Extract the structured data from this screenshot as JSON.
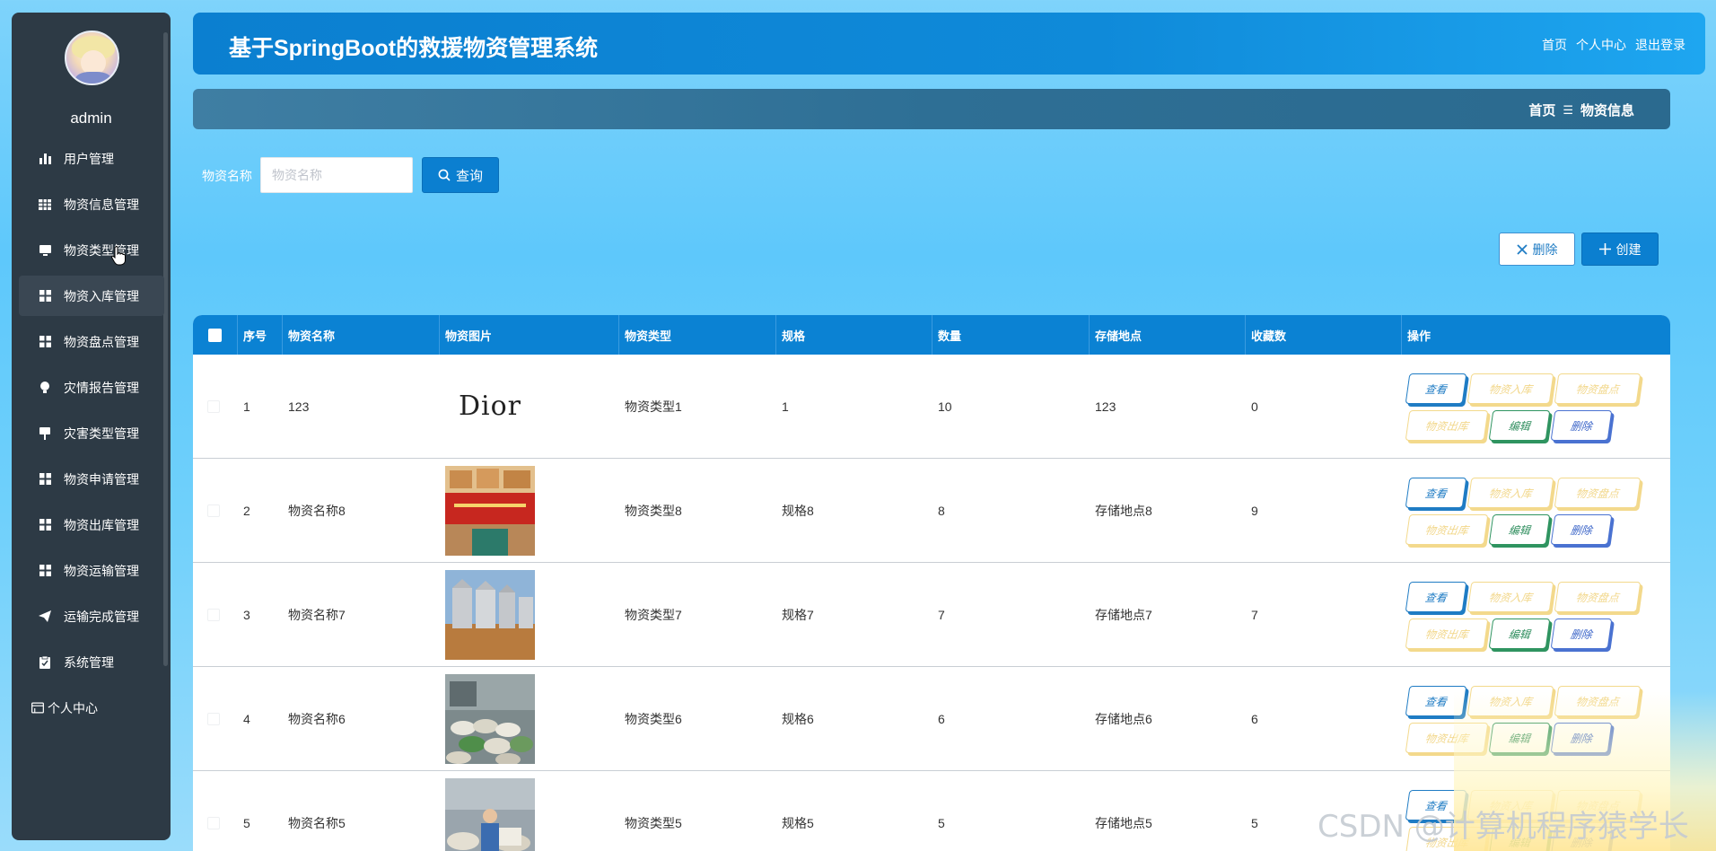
{
  "sidebar": {
    "username": "admin",
    "items": [
      {
        "label": "用户管理",
        "icon": "bar-chart-icon"
      },
      {
        "label": "物资信息管理",
        "icon": "grid-icon"
      },
      {
        "label": "物资类型管理",
        "icon": "monitor-icon"
      },
      {
        "label": "物资入库管理",
        "icon": "apps-icon"
      },
      {
        "label": "物资盘点管理",
        "icon": "apps-icon"
      },
      {
        "label": "灾情报告管理",
        "icon": "bulb-icon"
      },
      {
        "label": "灾害类型管理",
        "icon": "projector-icon"
      },
      {
        "label": "物资申请管理",
        "icon": "apps-icon"
      },
      {
        "label": "物资出库管理",
        "icon": "apps-icon"
      },
      {
        "label": "物资运输管理",
        "icon": "apps-icon"
      },
      {
        "label": "运输完成管理",
        "icon": "send-icon"
      },
      {
        "label": "系统管理",
        "icon": "clipboard-icon"
      },
      {
        "label": "个人中心",
        "icon": "card-icon"
      }
    ]
  },
  "header": {
    "title": "基于SpringBoot的救援物资管理系统",
    "links": [
      "首页",
      "个人中心",
      "退出登录"
    ]
  },
  "breadcrumb": {
    "home": "首页",
    "separator": "☰",
    "current": "物资信息"
  },
  "search": {
    "label": "物资名称",
    "placeholder": "物资名称",
    "value": "",
    "button": "查询"
  },
  "actions": {
    "delete": "删除",
    "create": "创建"
  },
  "table": {
    "headers": [
      "序号",
      "物资名称",
      "物资图片",
      "物资类型",
      "规格",
      "数量",
      "存储地点",
      "收藏数",
      "操作"
    ],
    "rows": [
      {
        "no": "1",
        "name": "123",
        "image": "Dior",
        "type": "物资类型1",
        "spec": "1",
        "qty": "10",
        "location": "123",
        "favorites": "0"
      },
      {
        "no": "2",
        "name": "物资名称8",
        "image": "warehouse-boxes-photo",
        "type": "物资类型8",
        "spec": "规格8",
        "qty": "8",
        "location": "存储地点8",
        "favorites": "9"
      },
      {
        "no": "3",
        "name": "物资名称7",
        "image": "grain-silos-photo",
        "type": "物资类型7",
        "spec": "规格7",
        "qty": "7",
        "location": "存储地点7",
        "favorites": "7"
      },
      {
        "no": "4",
        "name": "物资名称6",
        "image": "sacks-truck-photo",
        "type": "物资类型6",
        "spec": "规格6",
        "qty": "6",
        "location": "存储地点6",
        "favorites": "6"
      },
      {
        "no": "5",
        "name": "物资名称5",
        "image": "worker-sacks-photo",
        "type": "物资类型5",
        "spec": "规格5",
        "qty": "5",
        "location": "存储地点5",
        "favorites": "5"
      }
    ],
    "row_actions": {
      "view": "查看",
      "stock_in": "物资入库",
      "inventory": "物资盘点",
      "stock_out": "物资出库",
      "edit": "编辑",
      "delete": "删除"
    }
  },
  "watermark": "CSDN @计算机程序猿学长",
  "colors": {
    "primary": "#0b7fd0",
    "sidebar": "#2d3a45",
    "view": "#1f7cc4",
    "warn": "#f3d98c",
    "edit": "#2f9460",
    "danger": "#4a72d1"
  }
}
